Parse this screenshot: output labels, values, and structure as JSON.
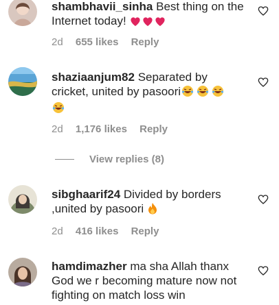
{
  "comments": [
    {
      "username": "shambhavii_sinha",
      "text": "Best thing on the Internet today!",
      "emoji": "❤️❤️❤️",
      "time": "2d",
      "likes": "655 likes",
      "reply": "Reply"
    },
    {
      "username": "shaziaanjum82",
      "text": "Separated by cricket, united by pasoori",
      "emoji": "😂😂😂😂",
      "time": "2d",
      "likes": "1,176 likes",
      "reply": "Reply",
      "view_replies": "View replies (8)"
    },
    {
      "username": "sibghaarif24",
      "text": "Divided by borders ,united by pasoori",
      "emoji": "🔥",
      "time": "2d",
      "likes": "416 likes",
      "reply": "Reply"
    },
    {
      "username": "hamdimazher",
      "text": "ma sha Allah thanx God we r becoming mature now not fighting on match loss win",
      "emoji": "",
      "time": "",
      "likes": "",
      "reply": ""
    }
  ],
  "icons": {
    "like": "heart-outline-icon"
  },
  "colors": {
    "text": "#262626",
    "meta": "#8e8e8e",
    "heart_emoji": "#e0245e",
    "fire_emoji": "#f4900c"
  }
}
